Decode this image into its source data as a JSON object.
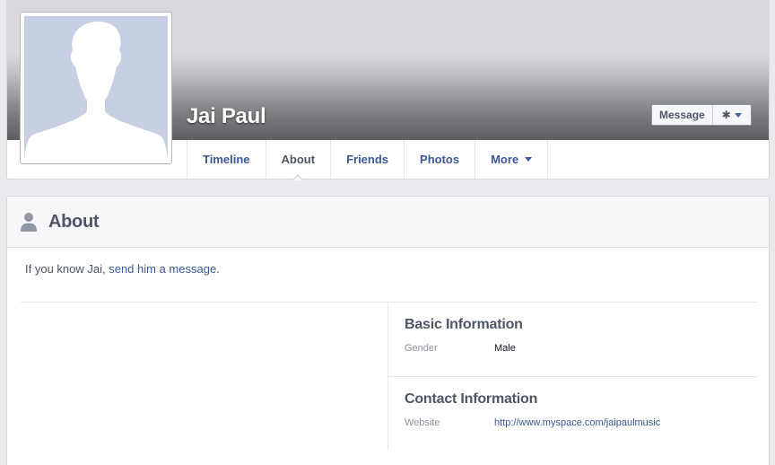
{
  "profile": {
    "name": "Jai Paul"
  },
  "actions": {
    "message_label": "Message",
    "gear_icon": "gear-icon"
  },
  "tabs": [
    {
      "label": "Timeline",
      "active": false
    },
    {
      "label": "About",
      "active": true
    },
    {
      "label": "Friends",
      "active": false
    },
    {
      "label": "Photos",
      "active": false
    },
    {
      "label": "More",
      "active": false,
      "has_dropdown": true
    }
  ],
  "about": {
    "title": "About",
    "intro_prefix": "If you know Jai, ",
    "intro_link": "send him a message",
    "intro_suffix": ".",
    "basic_info": {
      "title": "Basic Information",
      "gender_label": "Gender",
      "gender_value": "Male"
    },
    "contact_info": {
      "title": "Contact Information",
      "website_label": "Website",
      "website_value": "http://www.myspace.com/jaipaulmusic"
    }
  },
  "colors": {
    "link": "#3b5998",
    "page_bg": "#e9eaed",
    "placeholder_bg": "#c7d0e3"
  }
}
